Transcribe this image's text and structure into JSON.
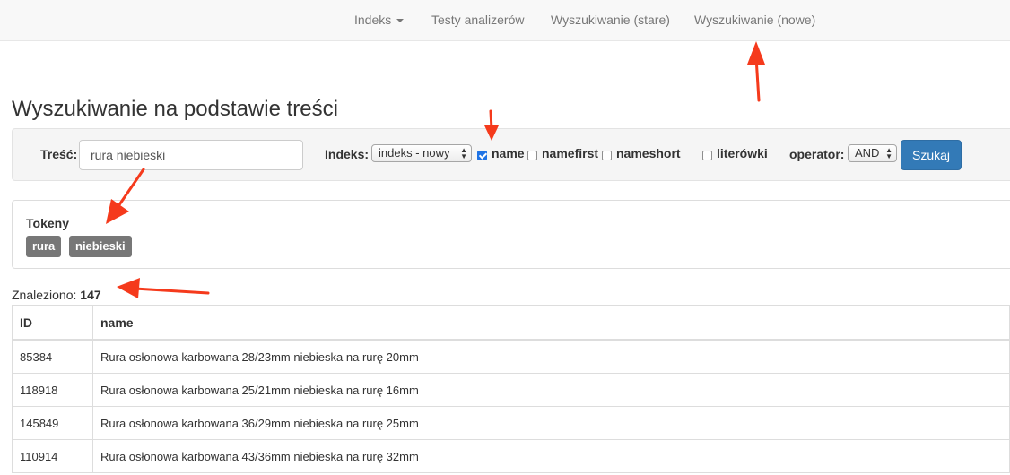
{
  "nav": {
    "items": [
      {
        "label": "Indeks",
        "has_dropdown": true
      },
      {
        "label": "Testy analizerów"
      },
      {
        "label": "Wyszukiwanie (stare)"
      },
      {
        "label": "Wyszukiwanie (nowe)"
      }
    ]
  },
  "page_title": "Wyszukiwanie na podstawie treści",
  "search": {
    "content_label": "Treść:",
    "content_value": "rura niebieski",
    "index_label": "Indeks:",
    "index_value": "indeks - nowy",
    "fields": [
      {
        "label": "name",
        "checked": true
      },
      {
        "label": "namefirst",
        "checked": false
      },
      {
        "label": "nameshort",
        "checked": false
      },
      {
        "label": "literówki",
        "checked": false
      }
    ],
    "operator_label": "operator:",
    "operator_value": "AND",
    "submit_label": "Szukaj"
  },
  "tokens": {
    "title": "Tokeny",
    "items": [
      "rura",
      "niebieski"
    ]
  },
  "results": {
    "found_label": "Znaleziono:",
    "found_count": "147",
    "columns": [
      "ID",
      "name"
    ],
    "rows": [
      {
        "id": "85384",
        "name": "Rura osłonowa karbowana 28/23mm niebieska na rurę 20mm"
      },
      {
        "id": "118918",
        "name": "Rura osłonowa karbowana 25/21mm niebieska na rurę 16mm"
      },
      {
        "id": "145849",
        "name": "Rura osłonowa karbowana 36/29mm niebieska na rurę 25mm"
      },
      {
        "id": "110914",
        "name": "Rura osłonowa karbowana 43/36mm niebieska na rurę 32mm"
      }
    ]
  },
  "colors": {
    "primary_button": "#337ab7",
    "token_badge": "#777777",
    "annotation_arrow": "#f53a1c",
    "checkbox_checked": "#1f73e5"
  }
}
